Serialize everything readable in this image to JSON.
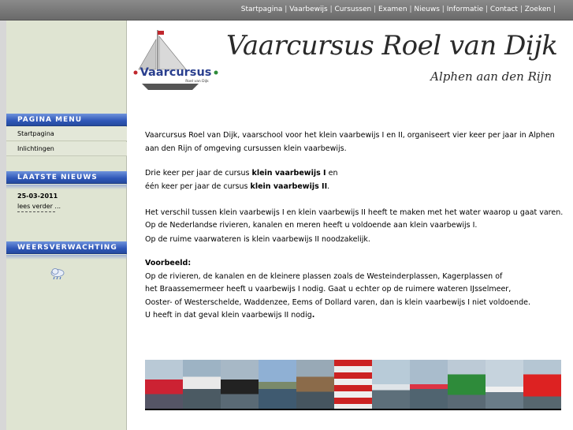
{
  "topnav": {
    "items": [
      "Startpagina",
      "Vaarbewijs",
      "Cursussen",
      "Examen",
      "Nieuws",
      "Informatie",
      "Contact",
      "Zoeken"
    ],
    "separator": "|"
  },
  "logo": {
    "name": "Vaarcursus",
    "sub": "Roel van Dijk"
  },
  "header": {
    "title": "Vaarcursus Roel van Dijk",
    "subtitle": "Alphen aan den Rijn"
  },
  "sidebar": {
    "menu_title": "PAGINA MENU",
    "menu_items": [
      "Startpagina",
      "Inlichtingen"
    ],
    "news_title": "LAATSTE NIEUWS",
    "news": {
      "date": "25-03-2011",
      "more": "lees verder ..."
    },
    "weather_title": "WEERSVERWACHTING",
    "weather_icon": "rain-cloud-icon"
  },
  "content": {
    "intro": "Vaarcursus Roel van Dijk, vaarschool voor het klein vaarbewijs I en II, organiseert vier keer per jaar in Alphen aan den Rijn of omgeving cursussen klein vaarbewijs.",
    "freq1_pre": "Drie keer per jaar de cursus ",
    "freq1_bold": "klein vaarbewijs I",
    "freq1_post": " en",
    "freq2_pre": "één keer per jaar de cursus ",
    "freq2_bold": "klein vaarbewijs II",
    "freq2_post": ".",
    "diff1": "Het verschil tussen klein vaarbewijs I en klein vaarbewijs II heeft te maken met het  water waarop u gaat varen.",
    "diff2": "Op de Nederlandse rivieren, kanalen en meren heeft u voldoende aan klein vaarbewijs I.",
    "diff3": "Op de ruime vaarwateren is klein vaarbewijs II noodzakelijk.",
    "example_title": "Voorbeeld:",
    "ex1": "Op de rivieren, de kanalen en de kleinere plassen zoals de Westeinderplassen,  Kagerplassen of",
    "ex2": "het Braassemermeer heeft u vaarbewijs I nodig. Gaat u echter op de ruimere wateren IJsselmeer,",
    "ex3": "Ooster- of Westerschelde, Waddenzee,  Eems of Dollard varen, dan is klein vaarbewijs I niet voldoende.",
    "ex4_text": "U heeft in dat geval klein vaarbewijs II nodig",
    "ex4_end": "."
  },
  "colors": {
    "accent": "#2f57b8",
    "sidebar": "#dfe4d2",
    "topbar": "#7a7a7a"
  }
}
